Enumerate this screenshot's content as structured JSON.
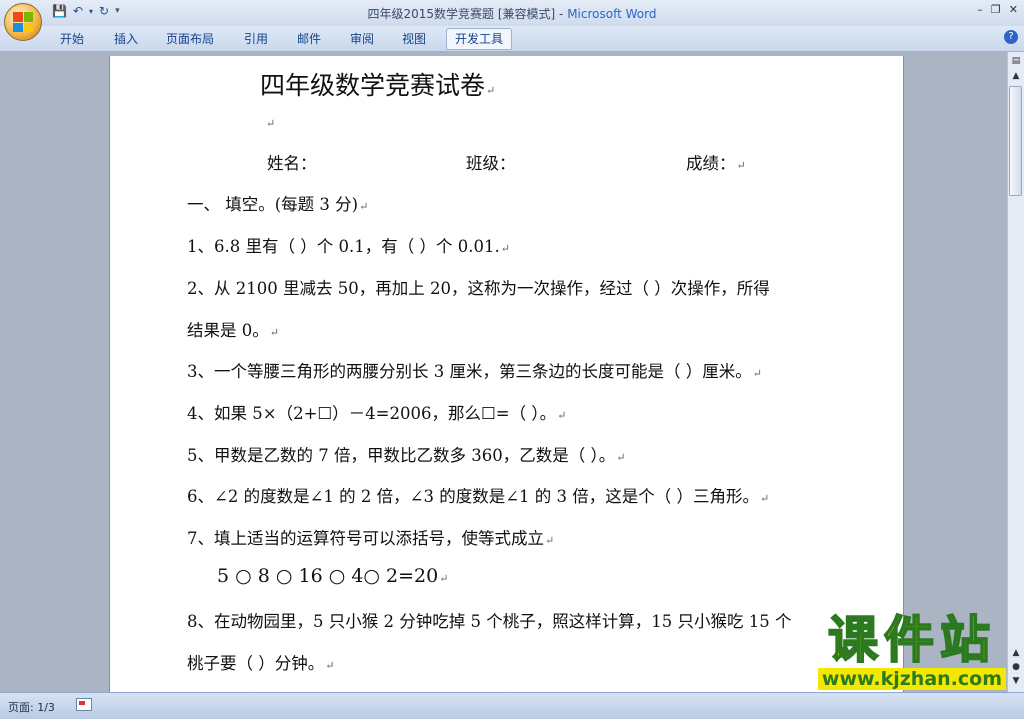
{
  "window": {
    "title_doc": "四年级2015数学竞赛题 [兼容模式]",
    "title_sep": " - ",
    "title_app": "Microsoft Word"
  },
  "quick_access": {
    "save_icon": "save-icon",
    "undo_icon": "undo-icon",
    "redo_icon": "redo-icon"
  },
  "ribbon": {
    "tabs": [
      "开始",
      "插入",
      "页面布局",
      "引用",
      "邮件",
      "审阅",
      "视图",
      "开发工具"
    ],
    "active_tab": "开发工具"
  },
  "document": {
    "title": "四年级数学竞赛试卷",
    "info": {
      "name": "姓名：",
      "class": "班级：",
      "score": "成绩："
    },
    "lines": [
      "一、    填空。(每题 3 分)",
      "1、6.8 里有（      ）个 0.1，有（      ）个 0.01.",
      "2、从 2100 里减去 50，再加上 20，这称为一次操作，经过（      ）次操作，所得",
      "结果是 0。",
      "3、一个等腰三角形的两腰分别长 3 厘米，第三条边的长度可能是（      ）厘米。",
      "4、如果 5×（2+☐）－4=2006，那么☐=（        ）。",
      "5、甲数是乙数的 7 倍，甲数比乙数多 360，乙数是（        ）。",
      "6、∠2 的度数是∠1 的 2 倍，∠3 的度数是∠1 的 3 倍，这是个（      ）三角形。",
      "7、填上适当的运算符号可以添括号，使等式成立",
      "5  ○  8  ○  16  ○  4○  2=20",
      "8、在动物园里，5 只小猴 2 分钟吃掉 5 个桃子，照这样计算，15 只小猴吃 15 个",
      "桃子要（        ）分钟。"
    ],
    "paragraph_mark": "↵"
  },
  "statusbar": {
    "page": "页面: 1/3"
  },
  "watermark": {
    "title": "课件站",
    "url": "www.kjzhan.com"
  }
}
